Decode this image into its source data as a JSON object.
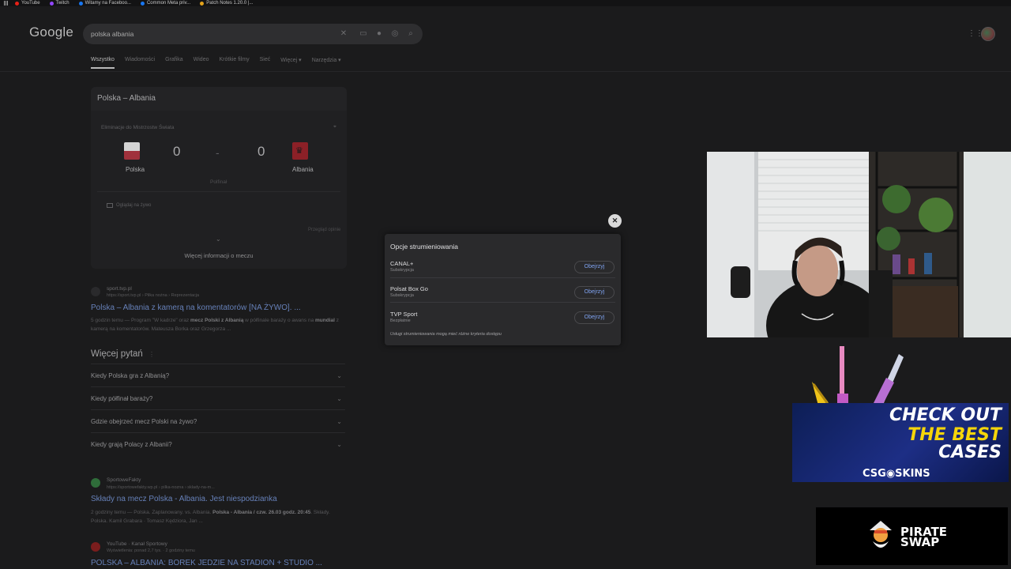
{
  "bookmarks": [
    {
      "label": "YouTube",
      "color": "#e62117"
    },
    {
      "label": "Twitch",
      "color": "#9146ff"
    },
    {
      "label": "Witamy na Faceboo...",
      "color": "#1877f2"
    },
    {
      "label": "Common Meta priv...",
      "color": "#1877f2"
    },
    {
      "label": "Patch Notes 1.20.0 |...",
      "color": "#e3a21a"
    }
  ],
  "header": {
    "logo": "Google",
    "query": "polska albania"
  },
  "tabs": [
    "Wszystko",
    "Wiadomości",
    "Grafika",
    "Wideo",
    "Krótkie filmy",
    "Sieć",
    "Więcej ▾",
    "Narzędzia ▾"
  ],
  "match": {
    "title": "Polska – Albania",
    "competition": "Eliminacje do Mistrzostw Świata",
    "home_team": "Polska",
    "away_team": "Albania",
    "home_score": "0",
    "away_score": "0",
    "separator": "-",
    "type": "Polfinał",
    "watch_live": "Oglądaj na żywo",
    "summary": "Przegląd opinie",
    "more_info": "Więcej informacji o meczu"
  },
  "result1": {
    "site": "sport.tvp.pl",
    "url": "https://sport.tvp.pl › Piłka nożna › Reprezentacja",
    "title": "Polska – Albania z kamerą na komentatorów [NA ŻYWO]. ...",
    "snippet_pre": "5 godzin temu — Program \"W kadrze\" oraz ",
    "snippet_bold": "mecz Polski z Albanią",
    "snippet_mid": " w półfinale baraży o awans na ",
    "snippet_bold2": "mundial",
    "snippet_post": " z kamerą na komentatorów. Mateusza Borka oraz Grzegorza ..."
  },
  "more_questions": {
    "title": "Więcej pytań",
    "items": [
      "Kiedy Polska gra z Albanią?",
      "Kiedy półfinał baraży?",
      "Gdzie obejrzeć mecz Polski na żywo?",
      "Kiedy grają Polacy z Albanii?"
    ]
  },
  "result2": {
    "site": "SportoweFakty",
    "url": "https://sportowefakty.wp.pl › pilka-nozna › sklady-na-m...",
    "title": "Składy na mecz Polska - Albania. Jest niespodzianka",
    "snippet_pre": "2 godziny temu — Polska. Zaplanowany. vs. Albania. ",
    "snippet_bold": "Polska - Albania / czw. 26.03 godz. 20:45",
    "snippet_post": ". Składy. Polska. Kamil Grabara · Tomasz Kędziora, Jan ..."
  },
  "result3": {
    "site": "YouTube · Kanał Sportowy",
    "url": "Wyświetlenia: ponad 2,7 tys. · 2 godziny temu",
    "title": "POLSKA – ALBANIA: BOREK JEDZIE NA STADION + STUDIO ..."
  },
  "streaming_dialog": {
    "title": "Opcje strumieniowania",
    "services": [
      {
        "name": "CANAL+",
        "note": "Subskrypcja",
        "button": "Obejrzyj"
      },
      {
        "name": "Polsat Box Go",
        "note": "Subskrypcja",
        "button": "Obejrzyj"
      },
      {
        "name": "TVP Sport",
        "note": "Bezpłatnie",
        "button": "Obejrzyj"
      }
    ],
    "footer": "Usługi strumieniowania mogą mieć różne kryteria dostępu",
    "close": "✕"
  },
  "ad": {
    "line1": "CHECK OUT",
    "line2": "THE BEST",
    "line3": "CASES",
    "brand": "CSG◉SKINS"
  },
  "pirate_swap": {
    "line1": "PIRATE",
    "line2": "SWAP"
  },
  "colors": {
    "link": "#6680b8",
    "button_text": "#7fa2ef",
    "accent_yellow": "#f5d50a"
  }
}
